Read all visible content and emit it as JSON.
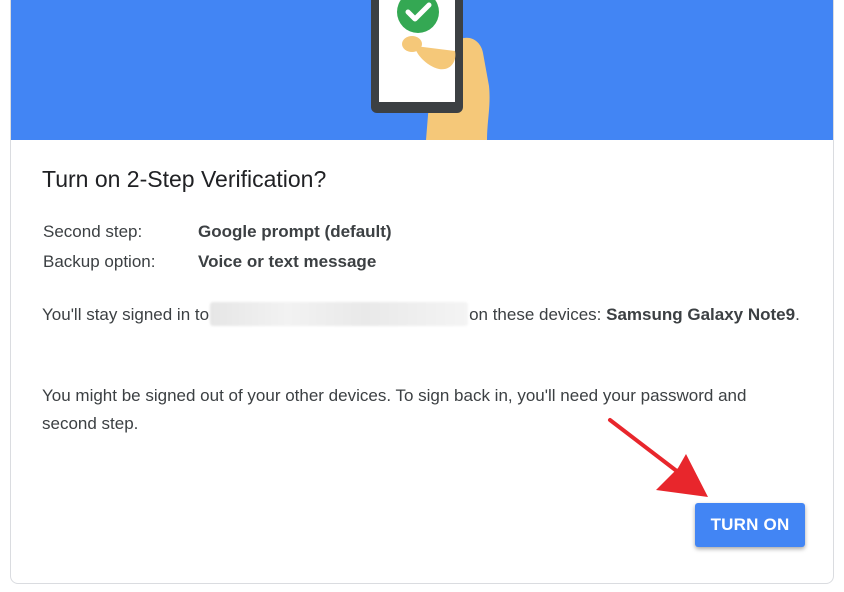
{
  "dialog": {
    "title": "Turn on 2-Step Verification?",
    "second_step_label": "Second step:",
    "second_step_value": "Google prompt (default)",
    "backup_label": "Backup option:",
    "backup_value": "Voice or text message",
    "signed_in_prefix": "You'll stay signed in to",
    "signed_in_middle": "on these devices:",
    "device_name": "Samsung Galaxy Note9",
    "signed_in_suffix": ".",
    "signout_text": "You might be signed out of your other devices. To sign back in, you'll need your password and second step.",
    "turn_on_label": "TURN ON"
  },
  "colors": {
    "banner": "#4285f4",
    "button": "#4285f4",
    "annotation_arrow": "#e8262c",
    "check": "#34a853"
  },
  "icons": {
    "illustration": "phone-in-hand-with-checkmark",
    "annotation": "red-arrow-pointing-to-button"
  }
}
